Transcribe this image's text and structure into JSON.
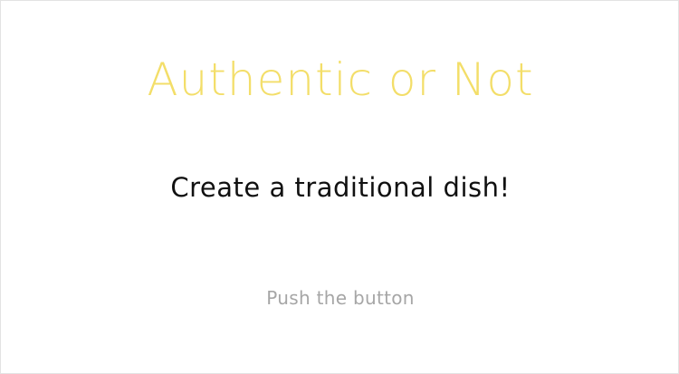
{
  "screen": {
    "title": "Authentic or Not",
    "subtitle": "Create a traditional dish!",
    "prompt": "Push the button"
  },
  "colors": {
    "background": "#ffffff",
    "title": "#f3de69",
    "subtitle": "#111111",
    "prompt": "#a6a6a6"
  }
}
